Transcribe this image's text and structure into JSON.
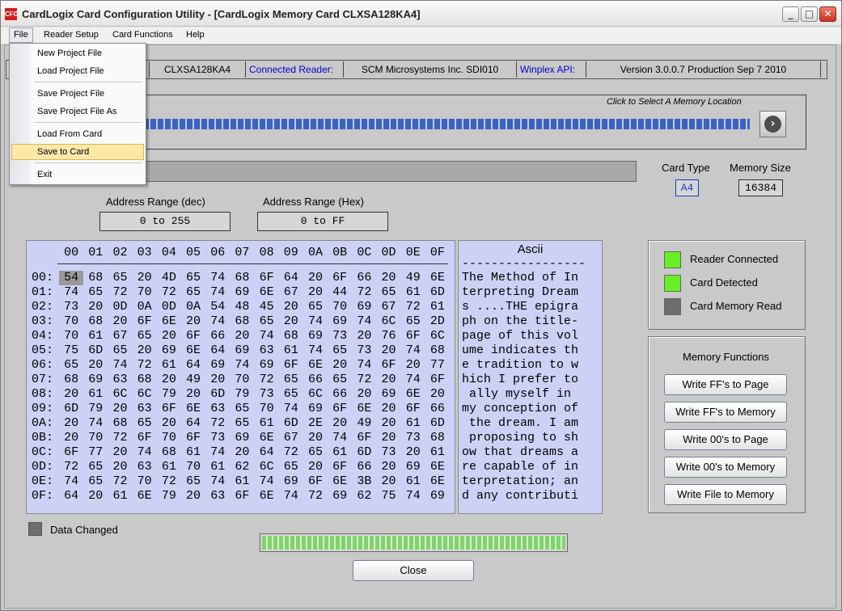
{
  "window": {
    "title": "CardLogix Card Configuration Utility - [CardLogix Memory Card CLXSA128KA4]",
    "icon_text": "CFG",
    "icons": {
      "minimize": "minimize-icon",
      "maximize": "maximize-icon",
      "close": "close-icon"
    }
  },
  "menu": [
    "File",
    "Reader Setup",
    "Card Functions",
    "Help"
  ],
  "file_menu": {
    "items": [
      "New Project File",
      "Load Project File",
      "Save Project File",
      "Save Project File As",
      "From Card",
      "Save to Card",
      "Exit"
    ],
    "load_from_card": "Load From Card",
    "highlighted": "Save to Card"
  },
  "info_bar": {
    "card_model": "CLXSA128KA4",
    "reader_label": "Connected Reader:",
    "reader_value": "SCM Microsystems Inc. SDI010",
    "api_label": "Winplex API:",
    "api_value": "Version 3.0.0.7 Production  Sep  7 2010"
  },
  "memory_location": {
    "hint": "Click to Select A Memory Location",
    "next_icon": "arrow-right-icon"
  },
  "card_type": {
    "label": "Card Type",
    "value": "A4"
  },
  "memory_size": {
    "label": "Memory Size",
    "value": "16384"
  },
  "address_dec": {
    "label": "Address Range (dec)",
    "value": "0 to 255"
  },
  "address_hex": {
    "label": "Address Range (Hex)",
    "value": "0 to FF"
  },
  "hex_header": [
    "00",
    "01",
    "02",
    "03",
    "04",
    "05",
    "06",
    "07",
    "08",
    "09",
    "0A",
    "0B",
    "0C",
    "0D",
    "0E",
    "0F"
  ],
  "hex_rows": [
    {
      "addr": "00:",
      "bytes": [
        "54",
        "68",
        "65",
        "20",
        "4D",
        "65",
        "74",
        "68",
        "6F",
        "64",
        "20",
        "6F",
        "66",
        "20",
        "49",
        "6E"
      ]
    },
    {
      "addr": "01:",
      "bytes": [
        "74",
        "65",
        "72",
        "70",
        "72",
        "65",
        "74",
        "69",
        "6E",
        "67",
        "20",
        "44",
        "72",
        "65",
        "61",
        "6D"
      ]
    },
    {
      "addr": "02:",
      "bytes": [
        "73",
        "20",
        "0D",
        "0A",
        "0D",
        "0A",
        "54",
        "48",
        "45",
        "20",
        "65",
        "70",
        "69",
        "67",
        "72",
        "61"
      ]
    },
    {
      "addr": "03:",
      "bytes": [
        "70",
        "68",
        "20",
        "6F",
        "6E",
        "20",
        "74",
        "68",
        "65",
        "20",
        "74",
        "69",
        "74",
        "6C",
        "65",
        "2D"
      ]
    },
    {
      "addr": "04:",
      "bytes": [
        "70",
        "61",
        "67",
        "65",
        "20",
        "6F",
        "66",
        "20",
        "74",
        "68",
        "69",
        "73",
        "20",
        "76",
        "6F",
        "6C"
      ]
    },
    {
      "addr": "05:",
      "bytes": [
        "75",
        "6D",
        "65",
        "20",
        "69",
        "6E",
        "64",
        "69",
        "63",
        "61",
        "74",
        "65",
        "73",
        "20",
        "74",
        "68"
      ]
    },
    {
      "addr": "06:",
      "bytes": [
        "65",
        "20",
        "74",
        "72",
        "61",
        "64",
        "69",
        "74",
        "69",
        "6F",
        "6E",
        "20",
        "74",
        "6F",
        "20",
        "77"
      ]
    },
    {
      "addr": "07:",
      "bytes": [
        "68",
        "69",
        "63",
        "68",
        "20",
        "49",
        "20",
        "70",
        "72",
        "65",
        "66",
        "65",
        "72",
        "20",
        "74",
        "6F"
      ]
    },
    {
      "addr": "08:",
      "bytes": [
        "20",
        "61",
        "6C",
        "6C",
        "79",
        "20",
        "6D",
        "79",
        "73",
        "65",
        "6C",
        "66",
        "20",
        "69",
        "6E",
        "20"
      ]
    },
    {
      "addr": "09:",
      "bytes": [
        "6D",
        "79",
        "20",
        "63",
        "6F",
        "6E",
        "63",
        "65",
        "70",
        "74",
        "69",
        "6F",
        "6E",
        "20",
        "6F",
        "66"
      ]
    },
    {
      "addr": "0A:",
      "bytes": [
        "20",
        "74",
        "68",
        "65",
        "20",
        "64",
        "72",
        "65",
        "61",
        "6D",
        "2E",
        "20",
        "49",
        "20",
        "61",
        "6D"
      ]
    },
    {
      "addr": "0B:",
      "bytes": [
        "20",
        "70",
        "72",
        "6F",
        "70",
        "6F",
        "73",
        "69",
        "6E",
        "67",
        "20",
        "74",
        "6F",
        "20",
        "73",
        "68"
      ]
    },
    {
      "addr": "0C:",
      "bytes": [
        "6F",
        "77",
        "20",
        "74",
        "68",
        "61",
        "74",
        "20",
        "64",
        "72",
        "65",
        "61",
        "6D",
        "73",
        "20",
        "61"
      ]
    },
    {
      "addr": "0D:",
      "bytes": [
        "72",
        "65",
        "20",
        "63",
        "61",
        "70",
        "61",
        "62",
        "6C",
        "65",
        "20",
        "6F",
        "66",
        "20",
        "69",
        "6E"
      ]
    },
    {
      "addr": "0E:",
      "bytes": [
        "74",
        "65",
        "72",
        "70",
        "72",
        "65",
        "74",
        "61",
        "74",
        "69",
        "6F",
        "6E",
        "3B",
        "20",
        "61",
        "6E"
      ]
    },
    {
      "addr": "0F:",
      "bytes": [
        "64",
        "20",
        "61",
        "6E",
        "79",
        "20",
        "63",
        "6F",
        "6E",
        "74",
        "72",
        "69",
        "62",
        "75",
        "74",
        "69"
      ]
    }
  ],
  "ascii": {
    "title": "Ascii",
    "separator": "-----------------",
    "rows": [
      "The Method of In",
      "terpreting Dream",
      "s ....THE epigra",
      "ph on the title-",
      "page of this vol",
      "ume indicates th",
      "e tradition to w",
      "hich I prefer to",
      " ally myself in ",
      "my conception of",
      " the dream. I am",
      " proposing to sh",
      "ow that dreams a",
      "re capable of in",
      "terpretation; an",
      "d any contributi"
    ]
  },
  "status": {
    "reader_connected": "Reader Connected",
    "card_detected": "Card Detected",
    "card_memory_read": "Card Memory Read",
    "colors": {
      "on": "#67f022",
      "off": "#6e6e6e"
    }
  },
  "memory_functions": {
    "title": "Memory Functions",
    "buttons": [
      "Write FF's to Page",
      "Write FF's to Memory",
      "Write 00's to Page",
      "Write 00's to Memory",
      "Write File to Memory"
    ]
  },
  "data_changed": "Data Changed",
  "close_button": "Close"
}
